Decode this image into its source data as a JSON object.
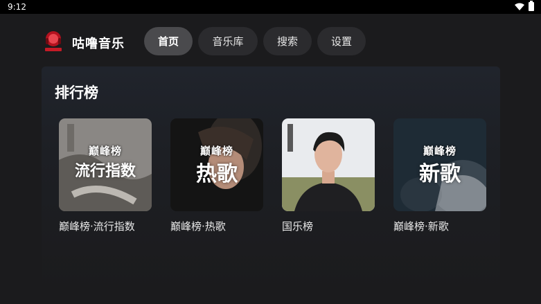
{
  "status_bar": {
    "time": "9:12"
  },
  "app": {
    "title": "咕噜音乐"
  },
  "nav": {
    "tabs": [
      {
        "label": "首页",
        "active": true
      },
      {
        "label": "音乐库",
        "active": false
      },
      {
        "label": "搜索",
        "active": false
      },
      {
        "label": "设置",
        "active": false
      }
    ]
  },
  "section": {
    "title": "排行榜"
  },
  "cards": [
    {
      "label": "巅峰榜·流行指数",
      "brand": "巅峰榜",
      "cover_text": "流行指数"
    },
    {
      "label": "巅峰榜·热歌",
      "brand": "巅峰榜",
      "cover_text": "热歌"
    },
    {
      "label": "国乐榜"
    },
    {
      "label": "巅峰榜·新歌",
      "brand": "巅峰榜",
      "cover_text": "新歌"
    }
  ],
  "colors": {
    "background": "#1b1b1d",
    "tab_active": "#4a4a4d",
    "tab_inactive": "#2b2b2e"
  }
}
